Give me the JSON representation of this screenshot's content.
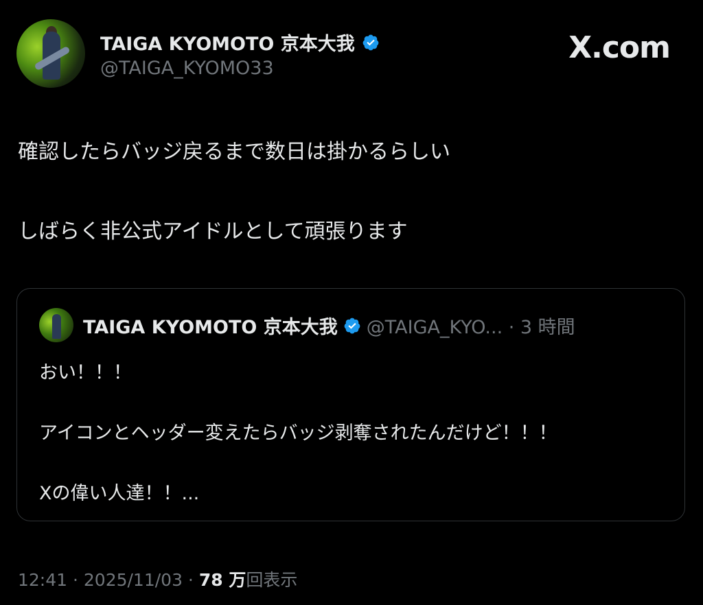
{
  "brand": "X.com",
  "author": {
    "name": "TAIGA KYOMOTO 京本大我",
    "handle": "@TAIGA_KYOMO33",
    "verified_color": "#1d9bf0"
  },
  "tweet": {
    "line1": "確認したらバッジ戻るまで数日は掛かるらしい",
    "line2": "しばらく非公式アイドルとして頑張ります"
  },
  "quoted": {
    "name": "TAIGA KYOMOTO 京本大我",
    "handle_time": "@TAIGA_KYO... · 3 時間",
    "line1": "おい！！！",
    "line2": "アイコンとヘッダー変えたらバッジ剥奪されたんだけど！！！",
    "line3": "Xの偉い人達！！..."
  },
  "meta": {
    "time_date": "12:41 · 2025/11/03 · ",
    "views_count": "78 万",
    "views_label": "回表示"
  },
  "icons": [
    "verified-badge-icon",
    "avatar"
  ]
}
